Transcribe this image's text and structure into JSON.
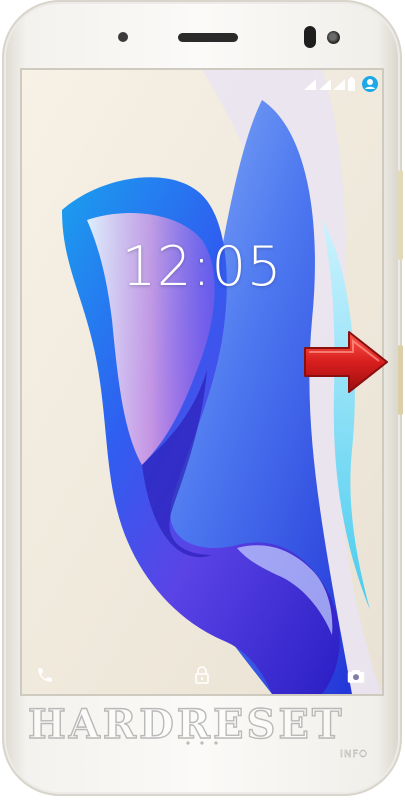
{
  "lock_screen": {
    "time": "12:05",
    "status_icons": [
      "signal-icon",
      "wifi-icon",
      "battery-icon",
      "account-icon"
    ],
    "shortcuts": {
      "left": "phone-icon",
      "center": "lock-icon",
      "right": "camera-icon"
    }
  },
  "watermark": {
    "text": "HARDRESET",
    "sub": "INFO"
  },
  "colors": {
    "screen_background": "#f2ede2",
    "accent_blue": "#2f6bff",
    "arrow_red": "#d81e1e",
    "account_badge": "#1ea8e8"
  }
}
